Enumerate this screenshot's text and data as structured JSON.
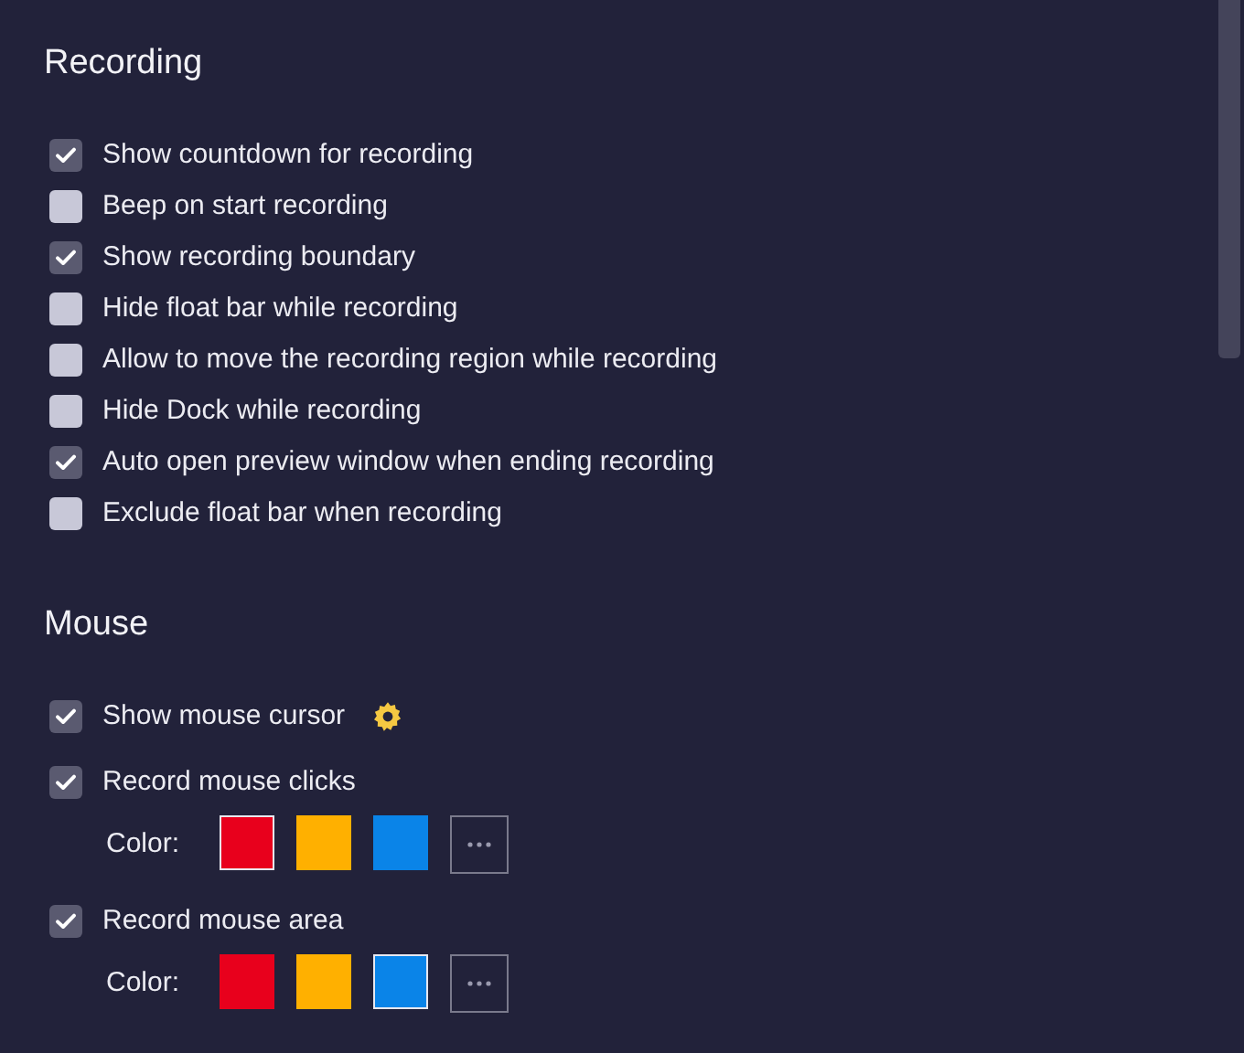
{
  "sections": [
    {
      "title": "Recording",
      "items": [
        {
          "kind": "checkbox",
          "label": "Show countdown for recording",
          "checked": true
        },
        {
          "kind": "checkbox",
          "label": "Beep on start recording",
          "checked": false
        },
        {
          "kind": "checkbox",
          "label": "Show recording boundary",
          "checked": true
        },
        {
          "kind": "checkbox",
          "label": "Hide float bar while recording",
          "checked": false
        },
        {
          "kind": "checkbox",
          "label": "Allow to move the recording region while recording",
          "checked": false
        },
        {
          "kind": "checkbox",
          "label": "Hide Dock while recording",
          "checked": false
        },
        {
          "kind": "checkbox",
          "label": "Auto open preview window when ending recording",
          "checked": true
        },
        {
          "kind": "checkbox",
          "label": "Exclude float bar when recording",
          "checked": false
        }
      ]
    },
    {
      "title": "Mouse",
      "items": [
        {
          "kind": "checkbox-settings",
          "label": "Show mouse cursor",
          "checked": true
        },
        {
          "kind": "checkbox",
          "label": "Record mouse clicks",
          "checked": true
        },
        {
          "kind": "colors",
          "label": "Color:",
          "swatches": [
            {
              "color": "#e8001c",
              "selected": true
            },
            {
              "color": "#ffb000",
              "selected": false
            },
            {
              "color": "#0a84e8",
              "selected": false
            }
          ]
        },
        {
          "kind": "checkbox",
          "label": "Record mouse area",
          "checked": true
        },
        {
          "kind": "colors",
          "label": "Color:",
          "swatches": [
            {
              "color": "#e8001c",
              "selected": false
            },
            {
              "color": "#ffb000",
              "selected": false
            },
            {
              "color": "#0a84e8",
              "selected": true
            }
          ]
        }
      ]
    }
  ]
}
